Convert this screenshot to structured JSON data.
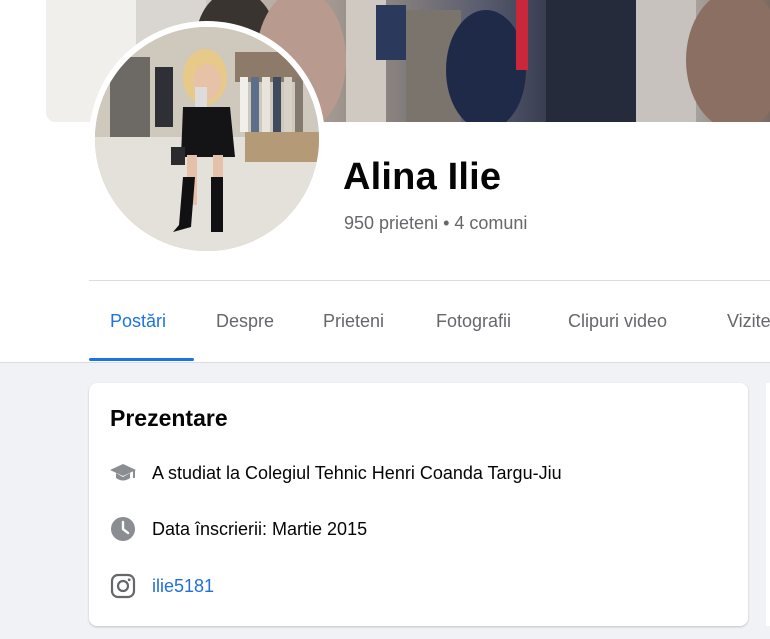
{
  "profile": {
    "name": "Alina Ilie",
    "friends_summary": "950 prieteni • 4 comuni"
  },
  "tabs": [
    {
      "label": "Postări",
      "active": true
    },
    {
      "label": "Despre",
      "active": false
    },
    {
      "label": "Prieteni",
      "active": false
    },
    {
      "label": "Fotografii",
      "active": false
    },
    {
      "label": "Clipuri video",
      "active": false
    },
    {
      "label": "Vizite",
      "active": false
    }
  ],
  "intro": {
    "title": "Prezentare",
    "items": [
      {
        "icon": "graduation-cap-icon",
        "text": "A studiat la Colegiul Tehnic Henri Coanda Targu-Jiu"
      },
      {
        "icon": "clock-icon",
        "text": "Data înscrierii: Martie 2015"
      },
      {
        "icon": "instagram-icon",
        "text": "ilie5181"
      }
    ]
  },
  "colors": {
    "accent": "#1b74e4",
    "link": "#216fdb",
    "secondary_text": "#65676b",
    "page_background": "#f0f2f5"
  }
}
